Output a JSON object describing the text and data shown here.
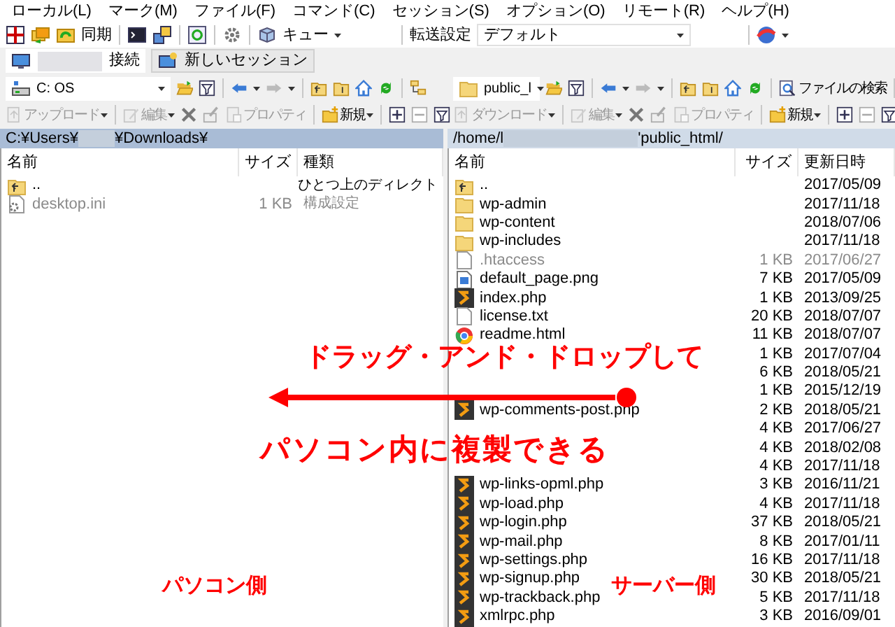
{
  "menu": [
    "ローカル(L)",
    "マーク(M)",
    "ファイル(F)",
    "コマンド(C)",
    "セッション(S)",
    "オプション(O)",
    "リモート(R)",
    "ヘルプ(H)"
  ],
  "toolbar": {
    "sync_label": "同期",
    "queue_label": "キュー",
    "transfer_label": "転送設定",
    "transfer_value": "デフォルト"
  },
  "tabs": [
    {
      "label": "接続",
      "selected": true,
      "redacted": true
    },
    {
      "label": "新しいセッション",
      "selected": false,
      "redacted": false
    }
  ],
  "panels": [
    {
      "active": true,
      "location": "C: OS",
      "actions": [
        {
          "label": "アップロード",
          "disabled": true
        },
        {
          "label": "編集",
          "disabled": true
        },
        {
          "label": "プロパティ",
          "disabled": true
        },
        {
          "label": "新規",
          "disabled": false
        }
      ],
      "path_prefix": "C:¥Users¥",
      "path_suffix": "¥Downloads¥",
      "columns": [
        "名前",
        "サイズ",
        "種類"
      ],
      "rows": [
        {
          "kind": "parent",
          "name": "..",
          "size": "",
          "col3": "ひとつ上のディレクト",
          "hidden": false
        },
        {
          "kind": "settings",
          "name": "desktop.ini",
          "size": "1 KB",
          "col3": "構成設定",
          "hidden": true
        }
      ]
    },
    {
      "active": false,
      "location": "public_l",
      "find_label": "ファイルの検索",
      "actions": [
        {
          "label": "ダウンロード",
          "disabled": true
        },
        {
          "label": "編集",
          "disabled": true
        },
        {
          "label": "プロパティ",
          "disabled": true
        },
        {
          "label": "新規",
          "disabled": false
        }
      ],
      "path_prefix": "/home/l",
      "path_suffix": "'public_html/",
      "columns": [
        "名前",
        "サイズ",
        "更新日時"
      ],
      "rows": [
        {
          "kind": "parent",
          "name": "..",
          "size": "",
          "col3": "2017/05/09",
          "hidden": false
        },
        {
          "kind": "folder",
          "name": "wp-admin",
          "size": "",
          "col3": "2017/11/18",
          "hidden": false
        },
        {
          "kind": "folder",
          "name": "wp-content",
          "size": "",
          "col3": "2018/07/06",
          "hidden": false
        },
        {
          "kind": "folder",
          "name": "wp-includes",
          "size": "",
          "col3": "2017/11/18",
          "hidden": false
        },
        {
          "kind": "text",
          "name": ".htaccess",
          "size": "1 KB",
          "col3": "2017/06/27",
          "hidden": true
        },
        {
          "kind": "image",
          "name": "default_page.png",
          "size": "7 KB",
          "col3": "2017/05/09",
          "hidden": false
        },
        {
          "kind": "php",
          "name": "index.php",
          "size": "1 KB",
          "col3": "2013/09/25",
          "hidden": false
        },
        {
          "kind": "text",
          "name": "license.txt",
          "size": "20 KB",
          "col3": "2018/07/07",
          "hidden": false
        },
        {
          "kind": "html",
          "name": "readme.html",
          "size": "11 KB",
          "col3": "2018/07/07",
          "hidden": false
        },
        {
          "size": "1 KB",
          "col3": "2017/07/04",
          "hidden": false
        },
        {
          "size": "6 KB",
          "col3": "2018/05/21",
          "hidden": false
        },
        {
          "size": "1 KB",
          "col3": "2015/12/19",
          "hidden": false
        },
        {
          "kind": "php",
          "name": "wp-comments-post.php",
          "size": "2 KB",
          "col3": "2018/05/21",
          "hidden": false
        },
        {
          "size": "4 KB",
          "col3": "2017/06/27",
          "hidden": false
        },
        {
          "size": "4 KB",
          "col3": "2018/02/08",
          "hidden": false
        },
        {
          "size": "4 KB",
          "col3": "2017/11/18",
          "hidden": false
        },
        {
          "kind": "php",
          "name": "wp-links-opml.php",
          "size": "3 KB",
          "col3": "2016/11/21",
          "hidden": false
        },
        {
          "kind": "php",
          "name": "wp-load.php",
          "size": "4 KB",
          "col3": "2017/11/18",
          "hidden": false
        },
        {
          "kind": "php",
          "name": "wp-login.php",
          "size": "37 KB",
          "col3": "2018/05/21",
          "hidden": false
        },
        {
          "kind": "php",
          "name": "wp-mail.php",
          "size": "8 KB",
          "col3": "2017/01/11",
          "hidden": false
        },
        {
          "kind": "php",
          "name": "wp-settings.php",
          "size": "16 KB",
          "col3": "2017/11/18",
          "hidden": false
        },
        {
          "kind": "php",
          "name": "wp-signup.php",
          "size": "30 KB",
          "col3": "2018/05/21",
          "hidden": false
        },
        {
          "kind": "php",
          "name": "wp-trackback.php",
          "size": "5 KB",
          "col3": "2017/11/18",
          "hidden": false
        },
        {
          "kind": "php",
          "name": "xmlrpc.php",
          "size": "3 KB",
          "col3": "2016/09/01",
          "hidden": false
        }
      ]
    }
  ],
  "annotation": {
    "drag_text": "ドラッグ・アンド・ドロップして",
    "copy_text": "パソコン内に複製できる",
    "left_label": "パソコン側",
    "right_label": "サーバー側"
  }
}
